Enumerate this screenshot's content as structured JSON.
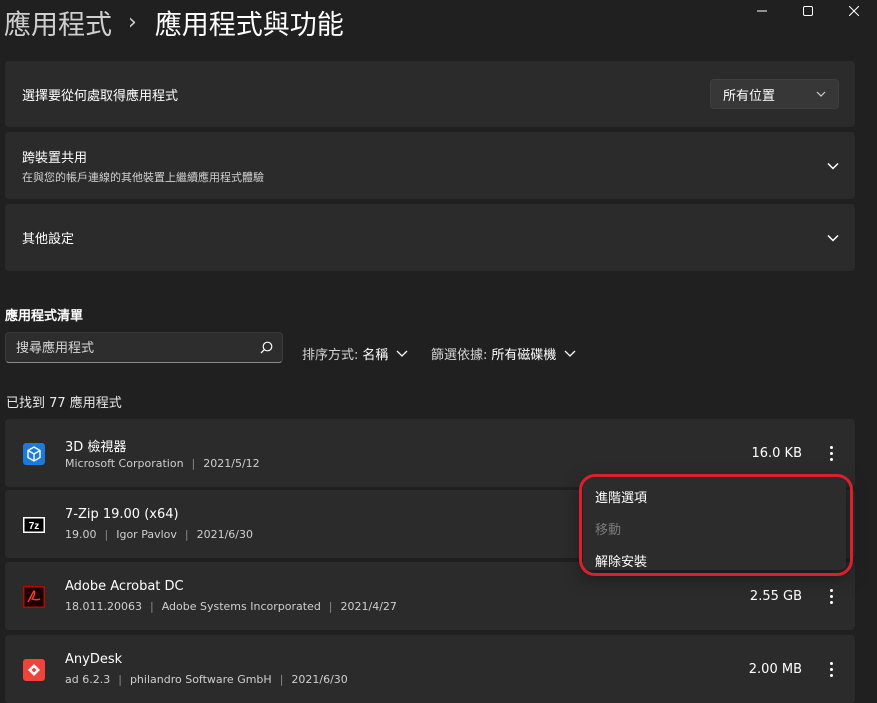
{
  "breadcrumb": {
    "parent": "應用程式",
    "current": "應用程式與功能"
  },
  "settings": {
    "source": {
      "label": "選擇要從何處取得應用程式",
      "dropdown_value": "所有位置"
    },
    "share": {
      "title": "跨裝置共用",
      "description": "在與您的帳戶連線的其他裝置上繼續應用程式體驗"
    },
    "more": {
      "title": "其他設定"
    }
  },
  "app_list": {
    "title": "應用程式清單",
    "search_placeholder": "搜尋應用程式",
    "sort": {
      "label": "排序方式:",
      "value": "名稱"
    },
    "filter": {
      "label": "篩選依據:",
      "value": "所有磁碟機"
    },
    "count_text": "已找到 77 應用程式",
    "apps": [
      {
        "name": "3D 檢視器",
        "publisher": "Microsoft Corporation",
        "date": "2021/5/12",
        "size": "16.0 KB",
        "icon": "cube-icon"
      },
      {
        "name": "7-Zip 19.00 (x64)",
        "version": "19.00",
        "publisher": "Igor Pavlov",
        "date": "2021/6/30",
        "size": "",
        "icon": "7zip-icon"
      },
      {
        "name": "Adobe Acrobat DC",
        "version": "18.011.20063",
        "publisher": "Adobe Systems Incorporated",
        "date": "2021/4/27",
        "size": "2.55 GB",
        "icon": "acrobat-icon"
      },
      {
        "name": "AnyDesk",
        "version": "ad 6.2.3",
        "publisher": "philandro Software GmbH",
        "date": "2021/6/30",
        "size": "2.00 MB",
        "icon": "anydesk-icon"
      }
    ]
  },
  "context_menu": {
    "items": [
      {
        "label": "進階選項",
        "enabled": true
      },
      {
        "label": "移動",
        "enabled": false
      },
      {
        "label": "解除安裝",
        "enabled": true
      }
    ],
    "highlight_color": "#d9202c"
  },
  "colors": {
    "background": "#202020",
    "card": "#2b2b2b"
  }
}
